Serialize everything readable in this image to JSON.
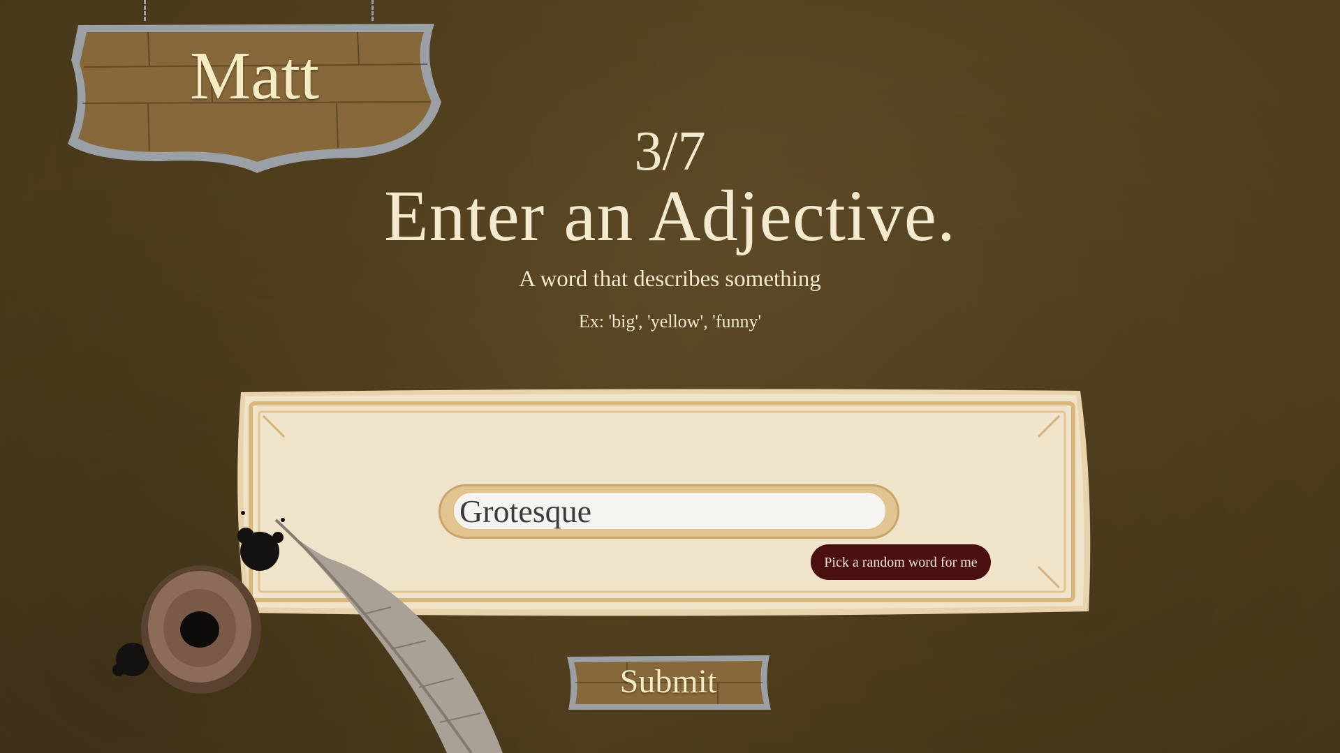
{
  "player": {
    "name": "Matt"
  },
  "prompt": {
    "progress": "3/7",
    "title": "Enter an Adjective.",
    "description": "A word that describes something",
    "example": "Ex: 'big', 'yellow', 'funny'"
  },
  "entry": {
    "value": "Grotesque"
  },
  "buttons": {
    "random_label": "Pick a random word for me",
    "submit_label": "Submit"
  },
  "colors": {
    "background": "#54421f",
    "text": "#f3ead0",
    "random_button": "#4a0f0f",
    "parchment": "#efe1c4"
  }
}
